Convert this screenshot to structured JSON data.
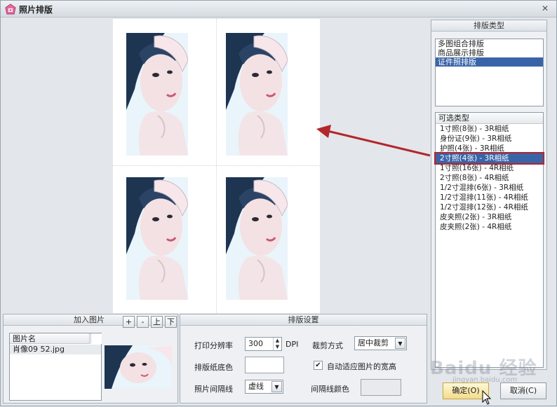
{
  "window": {
    "title": "照片排版",
    "close_glyph": "✕"
  },
  "layout_types": {
    "header": "排版类型",
    "items": [
      "多图组合排版",
      "商品展示排版",
      "证件照排版"
    ],
    "selected_index": 2
  },
  "photo_types": {
    "header": "可选类型",
    "items": [
      "1寸照(8张) - 3R相纸",
      "身份证(9张) - 3R相纸",
      "护照(4张) - 3R相纸",
      "2寸照(4张) - 3R相纸",
      "1寸照(16张) - 4R相纸",
      "2寸照(8张) - 4R相纸",
      "1/2寸混排(6张) - 3R相纸",
      "1/2寸混排(11张) - 4R相纸",
      "1/2寸混排(12张) - 4R相纸",
      "皮夹照(2张) - 3R相纸",
      "皮夹照(2张) - 4R相纸"
    ],
    "selected_index": 3
  },
  "add_picture": {
    "header": "加入图片",
    "buttons": {
      "add": "+",
      "remove": "-",
      "up": "上",
      "down": "下"
    },
    "column_header": "图片名",
    "files": [
      "肖像09 52.jpg"
    ]
  },
  "settings": {
    "header": "排版设置",
    "resolution_label": "打印分辨率",
    "resolution_value": "300",
    "resolution_unit": "DPI",
    "crop_label": "裁剪方式",
    "crop_value": "居中裁剪",
    "paper_color_label": "排版纸底色",
    "auto_fit_label": "自动适应图片的宽高",
    "auto_fit_checked": true,
    "separator_label": "照片间隔线",
    "separator_value": "虚线",
    "separator_color_label": "间隔线颜色"
  },
  "actions": {
    "ok": "确定(O)",
    "cancel": "取消(C)"
  },
  "watermark": {
    "text": "Baidu 经验",
    "sub": "jingyan.baidu.com"
  },
  "colors": {
    "accent": "#3a64a8",
    "annotation": "#b3262b",
    "ok_button": "#f3dc88"
  },
  "icons": [
    "app-icon",
    "close-icon",
    "spin-arrows-icon",
    "dropdown-arrow-icon",
    "checkbox-check-icon",
    "mouse-cursor-icon"
  ]
}
